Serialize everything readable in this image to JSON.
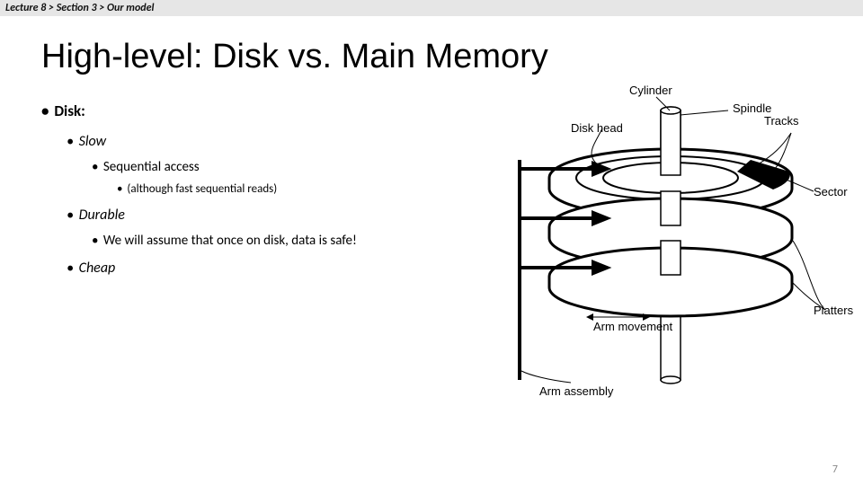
{
  "breadcrumb": "Lecture 8  >  Section 3  >  Our model",
  "title": "High-level: Disk vs. Main Memory",
  "bullets": {
    "l1": "Disk:",
    "l2a": "Slow",
    "l3a": "Sequential access",
    "l4a": "(although fast sequential reads)",
    "l2b": "Durable",
    "l3b": "We will assume that once on disk, data is safe!",
    "l2c": "Cheap"
  },
  "labels": {
    "cylinder": "Cylinder",
    "diskhead": "Disk head",
    "spindle": "Spindle",
    "tracks": "Tracks",
    "sector": "Sector",
    "armmove": "Arm movement",
    "armasm": "Arm assembly",
    "platters": "Platters"
  },
  "page": "7"
}
